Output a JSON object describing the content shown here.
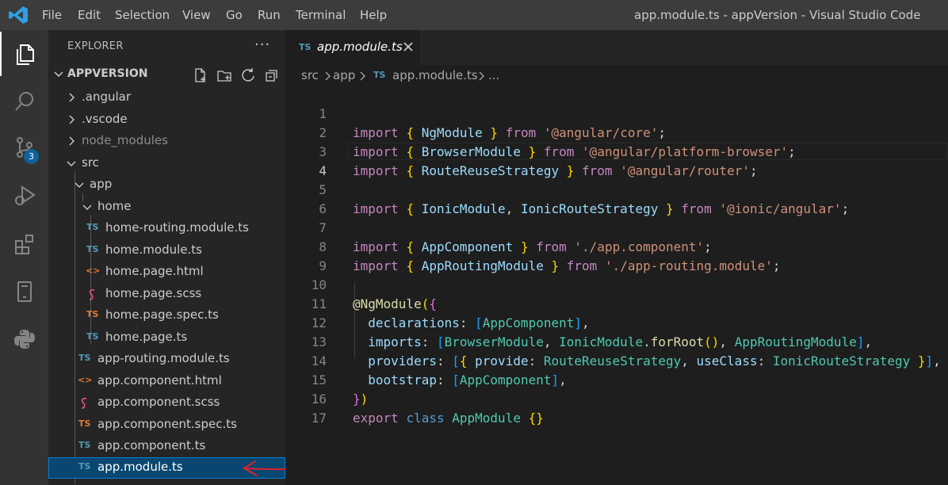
{
  "titlebar": {
    "menu": [
      "File",
      "Edit",
      "Selection",
      "View",
      "Go",
      "Run",
      "Terminal",
      "Help"
    ],
    "window_title": "app.module.ts - appVersion - Visual Studio Code"
  },
  "activitybar": {
    "icons": [
      "explorer-icon",
      "search-icon",
      "source-control-icon",
      "run-debug-icon",
      "extensions-icon",
      "remote-explorer-icon",
      "python-icon"
    ],
    "scm_badge": "3"
  },
  "sidebar": {
    "title": "EXPLORER",
    "more": "···",
    "project": "APPVERSION",
    "tree": [
      {
        "label": ".angular",
        "type": "folder",
        "expanded": false
      },
      {
        "label": ".vscode",
        "type": "folder",
        "expanded": false
      },
      {
        "label": "node_modules",
        "type": "folder",
        "expanded": false
      },
      {
        "label": "src",
        "type": "folder",
        "expanded": true
      },
      {
        "label": "app",
        "type": "folder",
        "expanded": true
      },
      {
        "label": "home",
        "type": "folder",
        "expanded": true
      },
      {
        "label": "home-routing.module.ts",
        "type": "ts",
        "icon": "TS"
      },
      {
        "label": "home.module.ts",
        "type": "ts",
        "icon": "TS"
      },
      {
        "label": "home.page.html",
        "type": "html",
        "icon": "<>"
      },
      {
        "label": "home.page.scss",
        "type": "scss",
        "icon": "scss"
      },
      {
        "label": "home.page.spec.ts",
        "type": "spec",
        "icon": "TS"
      },
      {
        "label": "home.page.ts",
        "type": "ts",
        "icon": "TS"
      },
      {
        "label": "app-routing.module.ts",
        "type": "ts",
        "icon": "TS"
      },
      {
        "label": "app.component.html",
        "type": "html",
        "icon": "<>"
      },
      {
        "label": "app.component.scss",
        "type": "scss",
        "icon": "scss"
      },
      {
        "label": "app.component.spec.ts",
        "type": "spec",
        "icon": "TS"
      },
      {
        "label": "app.component.ts",
        "type": "ts",
        "icon": "TS"
      },
      {
        "label": "app.module.ts",
        "type": "ts",
        "icon": "TS",
        "selected": true
      }
    ]
  },
  "editor": {
    "tab": {
      "icon": "TS",
      "label": "app.module.ts"
    },
    "breadcrumbs": {
      "src": "src",
      "app": "app",
      "file_icon": "TS",
      "file": "app.module.ts",
      "more": "..."
    },
    "current_line": 4,
    "lines": [
      "1",
      "2",
      "3",
      "4",
      "5",
      "6",
      "7",
      "8",
      "9",
      "10",
      "11",
      "12",
      "13",
      "14",
      "15",
      "16",
      "17"
    ],
    "code": {
      "import": "import",
      "from": "from",
      "export": "export",
      "class": "class",
      "NgModule": "NgModule",
      "BrowserModule": "BrowserModule",
      "RouteReuseStrategy": "RouteReuseStrategy",
      "IonicModule": "IonicModule",
      "IonicRouteStrategy": "IonicRouteStrategy",
      "AppComponent": "AppComponent",
      "AppRoutingModule": "AppRoutingModule",
      "AppModule": "AppModule",
      "s_core": "'@angular/core'",
      "s_pb": "'@angular/platform-browser'",
      "s_router": "'@angular/router'",
      "s_ionic": "'@ionic/angular'",
      "s_appcomp": "'./app.component'",
      "s_routing": "'./app-routing.module'",
      "at_ngmodule": "@NgModule",
      "declarations": "declarations",
      "imports": "imports",
      "providers": "providers",
      "bootstrap": "bootstrap",
      "forRoot": "forRoot",
      "provide": "provide",
      "useClass": "useClass"
    }
  },
  "colors": {
    "accent": "#007fd4",
    "selection": "#094771",
    "ts_icon": "#519aba",
    "annotation_arrow": "#e0202a"
  }
}
